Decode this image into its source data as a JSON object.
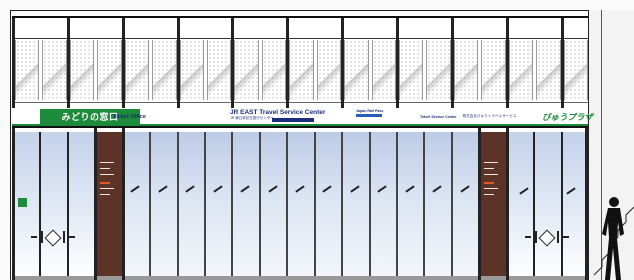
{
  "signage": {
    "midori": "みどりの窓口",
    "ticket_office": "Ticket Office",
    "jr_east": "JR EAST Travel Service Center",
    "jr_east_sub": "JR 東日本訪日旅行センター",
    "jr_pass": "Japan Rail Pass",
    "travel_service": "Travel Service Center",
    "travel_service_jp": "株式会社びゅうトラベルサービス",
    "view_plaza": "びゅうプラザ"
  },
  "colors": {
    "green": "#1e8b3c",
    "navy": "#1a2f7a",
    "brown_panel": "#5b3427",
    "glass": "#bccbe6"
  }
}
